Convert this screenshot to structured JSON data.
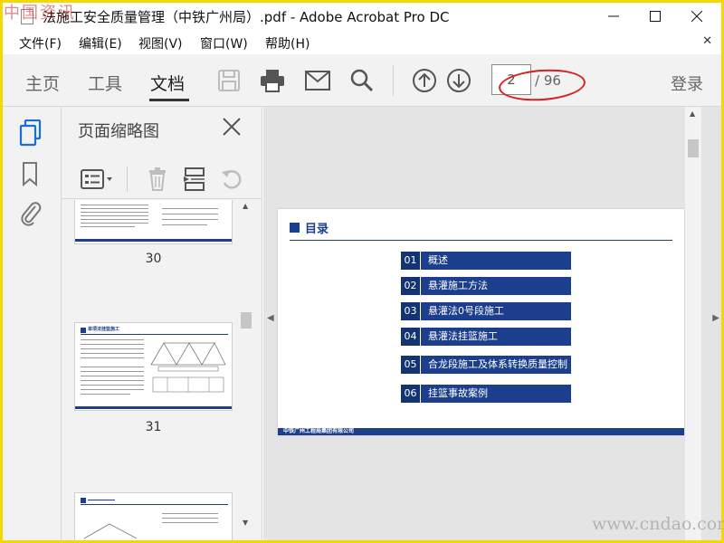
{
  "window": {
    "title": "法施工安全质量管理（中铁广州局）.pdf - Adobe Acrobat Pro DC",
    "watermark_top": "中国资讯",
    "watermark_bottom": "www.cndao.com"
  },
  "menu": {
    "items": [
      "文件(F)",
      "编辑(E)",
      "视图(V)",
      "窗口(W)",
      "帮助(H)"
    ]
  },
  "toolbar": {
    "tabs": [
      "主页",
      "工具",
      "文档"
    ],
    "active_tab": "文档",
    "page_current": "2",
    "page_total": "/ 96",
    "login": "登录"
  },
  "thumbnails": {
    "title": "页面缩略图",
    "pages": [
      "30",
      "31"
    ],
    "thumb31_heading": "单项法挂篮施工"
  },
  "document": {
    "toc_title": "目录",
    "toc_items": [
      {
        "num": "01",
        "text": "概述"
      },
      {
        "num": "02",
        "text": "悬灌施工方法"
      },
      {
        "num": "03",
        "text": "悬灌法0号段施工"
      },
      {
        "num": "04",
        "text": "悬灌法挂篮施工"
      },
      {
        "num": "05",
        "text": "合龙段施工及体系转换质量控制"
      },
      {
        "num": "06",
        "text": "挂篮事故案例"
      }
    ],
    "footer": "中铁广州工程局集团有限公司"
  },
  "colors": {
    "accent_blue": "#1b3f8c",
    "annotation_red": "#d81e1e",
    "frame_yellow": "#f5d800"
  }
}
